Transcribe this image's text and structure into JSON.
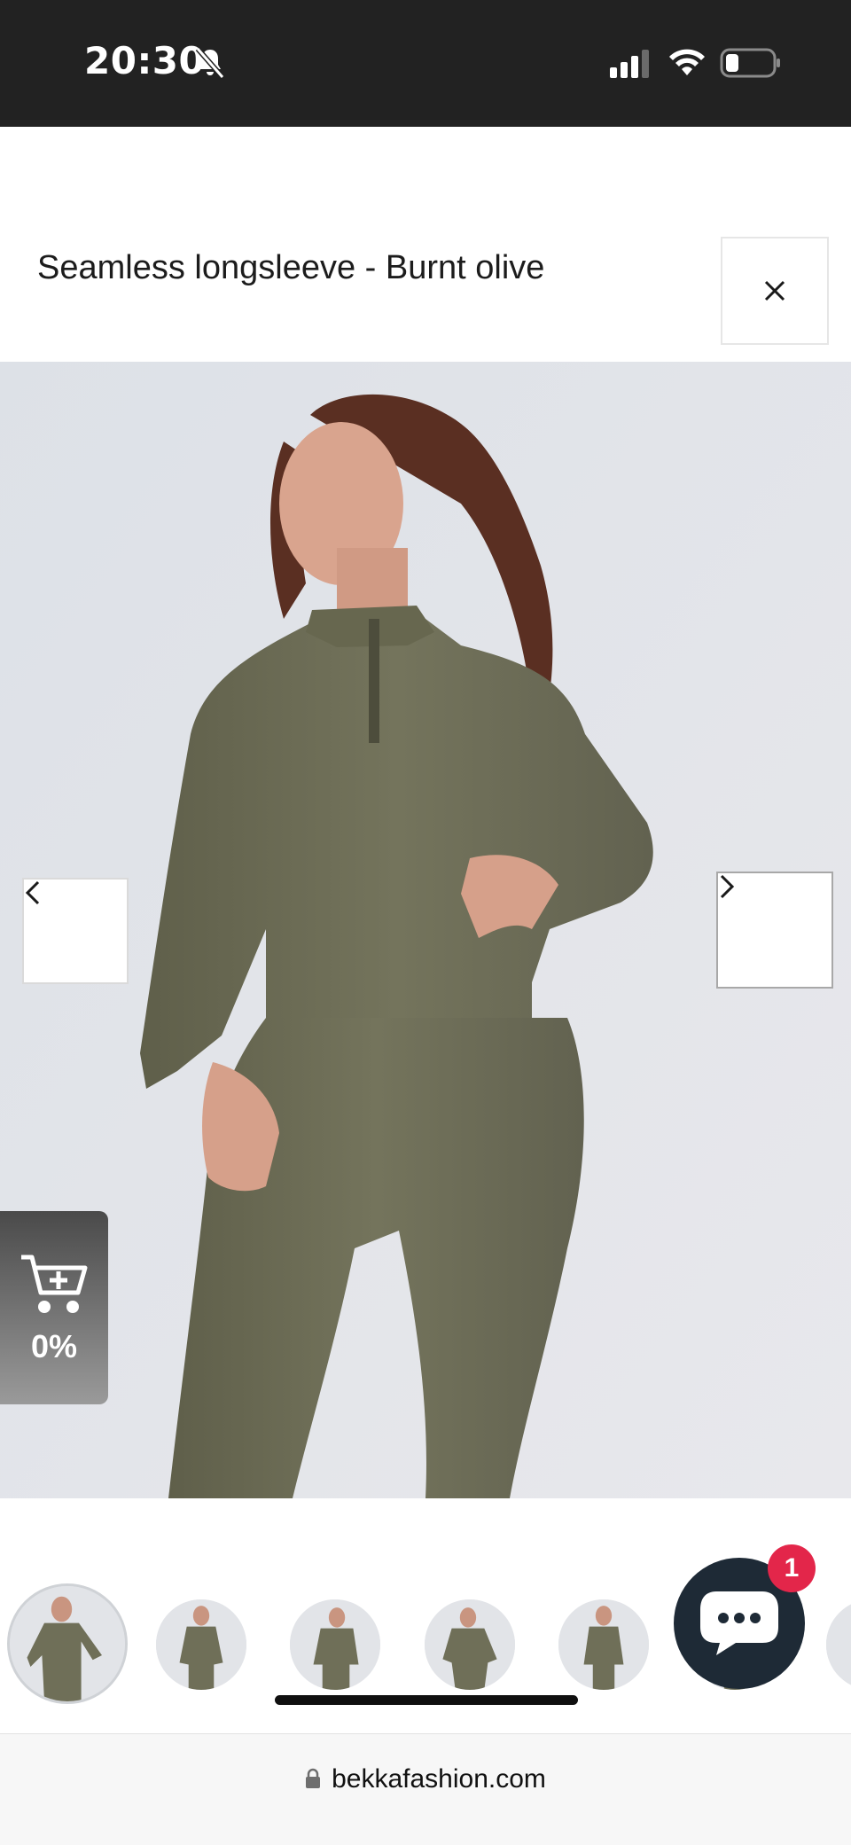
{
  "status_bar": {
    "time": "20:30",
    "icons": [
      "bell-slash-icon",
      "cellular-signal-icon",
      "wifi-icon",
      "battery-low-icon"
    ]
  },
  "modal": {
    "title": "Seamless longsleeve - Burnt olive",
    "close_icon": "close-icon"
  },
  "gallery": {
    "prev_icon": "chevron-left-icon",
    "next_icon": "chevron-right-icon",
    "garment_color": "#6f6f58",
    "thumbnails": 7,
    "active_thumbnail": 1
  },
  "cart_widget": {
    "icon": "cart-plus-icon",
    "percent": "0%"
  },
  "chat": {
    "icon": "chat-bubble-icon",
    "badge_count": "1"
  },
  "address_bar": {
    "lock_icon": "lock-icon",
    "url": "bekkafashion.com"
  },
  "colors": {
    "status_bar_bg": "#222222",
    "chat_bg": "#1e2a36",
    "badge_red": "#e3264a"
  }
}
